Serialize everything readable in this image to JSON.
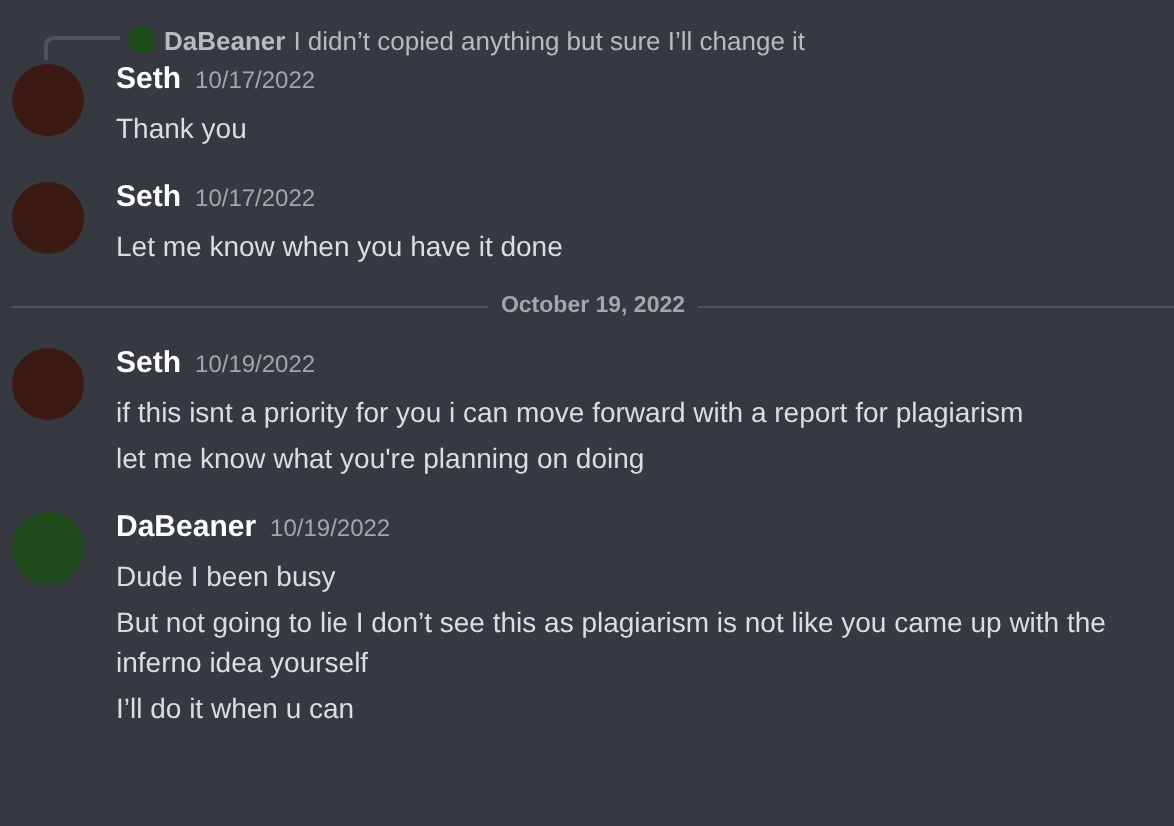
{
  "items": [
    {
      "kind": "message",
      "author": "Seth",
      "color": "#3a1a12",
      "timestamp": "10/17/2022",
      "reply": {
        "author": "DaBeaner",
        "color": "#1f4a1c",
        "text": "I didn’t copied anything but sure I’ll change it"
      },
      "lines": [
        "Thank you"
      ]
    },
    {
      "kind": "message",
      "author": "Seth",
      "color": "#3a1a12",
      "timestamp": "10/17/2022",
      "lines": [
        "Let me know when you have it done"
      ]
    },
    {
      "kind": "divider",
      "label": "October 19, 2022"
    },
    {
      "kind": "message",
      "author": "Seth",
      "color": "#3a1a12",
      "timestamp": "10/19/2022",
      "lines": [
        "if this isnt a priority for you i can move forward with a report for plagiarism",
        "let me know what you're planning on doing"
      ]
    },
    {
      "kind": "message",
      "author": "DaBeaner",
      "color": "#1f4a1c",
      "timestamp": "10/19/2022",
      "lines": [
        "Dude I been busy",
        "But not going to lie I don’t see this as plagiarism is not like you came up with the inferno idea yourself",
        "I’ll do it when u can"
      ]
    }
  ]
}
